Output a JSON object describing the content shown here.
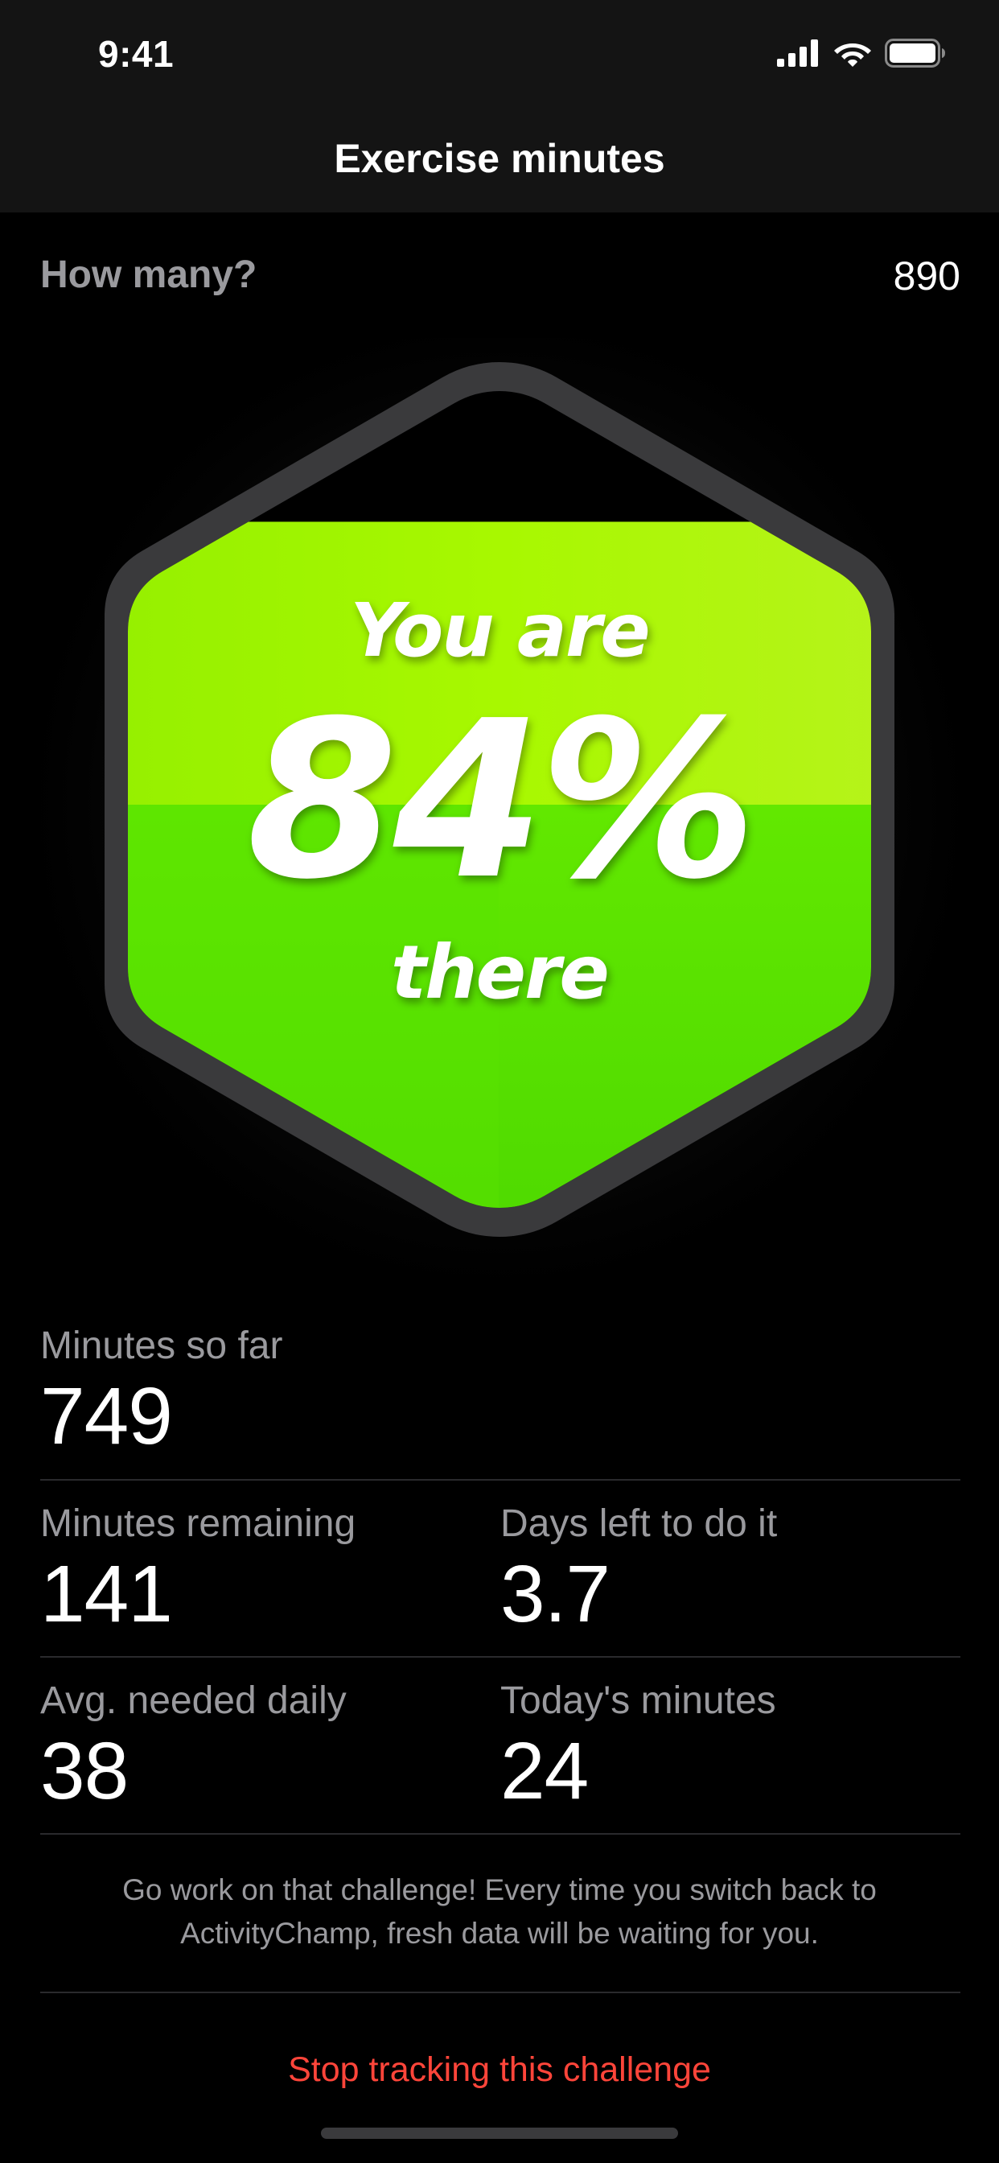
{
  "status_bar": {
    "time": "9:41",
    "icons": [
      "cellular-signal-icon",
      "wifi-icon",
      "battery-icon"
    ]
  },
  "nav": {
    "title": "Exercise minutes"
  },
  "how_many": {
    "label": "How many?",
    "value": "890"
  },
  "badge": {
    "line1": "You are",
    "percent": "84%",
    "line3": "there",
    "fill_fraction": 0.84,
    "colors": {
      "green_top": "#a8f700",
      "green_bottom": "#56e000",
      "frame": "#3a3a3c"
    }
  },
  "stats": {
    "so_far": {
      "label": "Minutes so far",
      "value": "749"
    },
    "remaining": {
      "label": "Minutes remaining",
      "value": "141"
    },
    "days_left": {
      "label": "Days left to do it",
      "value": "3.7"
    },
    "avg_daily": {
      "label": "Avg. needed daily",
      "value": "38"
    },
    "today": {
      "label": "Today's minutes",
      "value": "24"
    }
  },
  "footer": {
    "note": "Go work on that challenge! Every time you switch back to ActivityChamp, fresh data will be waiting for you.",
    "stop_label": "Stop tracking this challenge",
    "accent_color": "#ff453a"
  }
}
